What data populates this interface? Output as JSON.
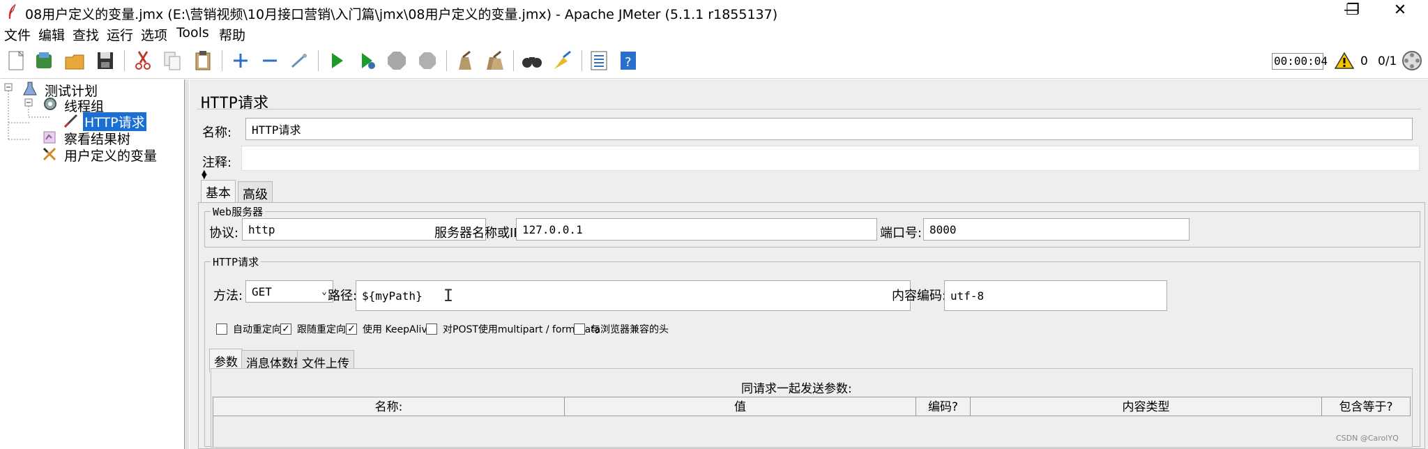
{
  "window": {
    "title": "08用户定义的变量.jmx (E:\\营销视频\\10月接口营销\\入门篇\\jmx\\08用户定义的变量.jmx) - Apache JMeter (5.1.1 r1855137)",
    "minimize": "—",
    "maximize": "❐",
    "close": "✕"
  },
  "menu": [
    "文件",
    "编辑",
    "查找",
    "运行",
    "选项",
    "Tools",
    "帮助"
  ],
  "toolbar_status": {
    "timer": "00:00:04",
    "warnings": "0",
    "threads": "0/1"
  },
  "tree": {
    "items": [
      {
        "label": "测试计划",
        "icon": "test-plan-icon"
      },
      {
        "label": "线程组",
        "icon": "thread-group-icon"
      },
      {
        "label": "HTTP请求",
        "icon": "http-sampler-icon",
        "selected": true
      },
      {
        "label": "察看结果树",
        "icon": "results-tree-icon"
      },
      {
        "label": "用户定义的变量",
        "icon": "user-vars-icon"
      }
    ]
  },
  "panel": {
    "heading": "HTTP请求",
    "name_label": "名称:",
    "name_value": "HTTP请求",
    "comment_label": "注释:",
    "comment_value": "",
    "tabs": [
      "基本",
      "高级"
    ],
    "web_server": {
      "title": "Web服务器",
      "protocol_label": "协议:",
      "protocol_value": "http",
      "server_label": "服务器名称或IP:",
      "server_value": "127.0.0.1",
      "port_label": "端口号:",
      "port_value": "8000"
    },
    "http_request": {
      "title": "HTTP请求",
      "method_label": "方法:",
      "method_value": "GET",
      "path_label": "路径:",
      "path_value": "${myPath}",
      "encoding_label": "内容编码:",
      "encoding_value": "utf-8"
    },
    "checkboxes": [
      {
        "label": "自动重定向",
        "checked": false
      },
      {
        "label": "跟随重定向",
        "checked": true
      },
      {
        "label": "使用 KeepAlive",
        "checked": true
      },
      {
        "label": "对POST使用multipart / form-data",
        "checked": false
      },
      {
        "label": "与浏览器兼容的头",
        "checked": false
      }
    ],
    "sub_tabs": [
      "参数",
      "消息体数据",
      "文件上传"
    ],
    "params_caption": "同请求一起发送参数:",
    "columns": [
      "名称:",
      "值",
      "编码?",
      "内容类型",
      "包含等于?"
    ]
  },
  "watermark": "CSDN @CarolYQ"
}
